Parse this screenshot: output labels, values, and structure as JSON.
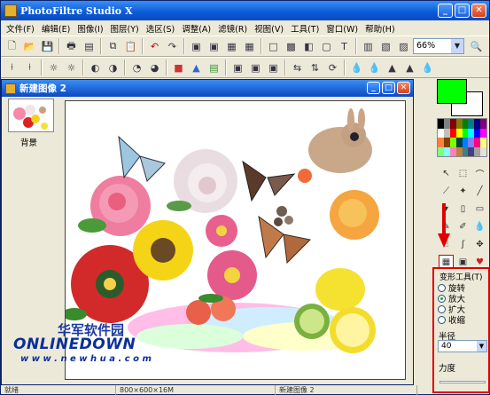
{
  "window": {
    "title": "PhotoFiltre Studio X"
  },
  "menu": {
    "items": [
      "文件(F)",
      "编辑(E)",
      "图像(I)",
      "图层(Y)",
      "选区(S)",
      "调整(A)",
      "滤镜(R)",
      "视图(V)",
      "工具(T)",
      "窗口(W)",
      "帮助(H)"
    ]
  },
  "toolbar": {
    "zoom": "66%"
  },
  "document": {
    "title": "新建图像 2"
  },
  "layers": {
    "items": [
      {
        "label": "背景"
      }
    ]
  },
  "tool_options": {
    "title": "变形工具(T)",
    "modes": [
      {
        "label": "旋转",
        "selected": false
      },
      {
        "label": "放大",
        "selected": true
      },
      {
        "label": "扩大",
        "selected": false
      },
      {
        "label": "收缩",
        "selected": false
      }
    ],
    "radius_label": "半径",
    "radius_value": "40",
    "strength_label": "力度"
  },
  "status": {
    "left": "就绪",
    "size": "800×600×16M",
    "doc": "新建图像 2"
  },
  "watermark": {
    "cn": "华军软件园",
    "en": "ONLINEDOWN",
    "url": "w w w . n e w h u a . c o m"
  },
  "colors": {
    "accent": "#0b49c0",
    "highlight": "#e00000",
    "foreground": "#00ff00"
  }
}
